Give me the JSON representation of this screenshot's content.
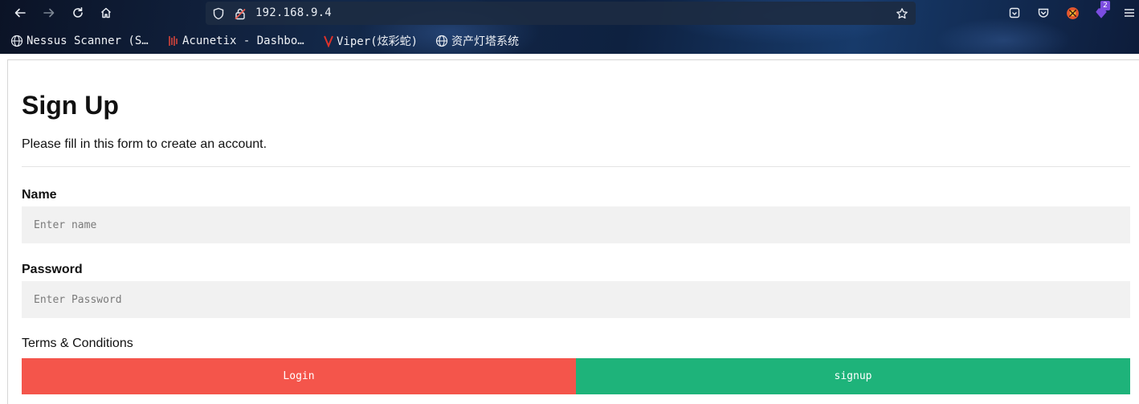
{
  "browser": {
    "url": "192.168.9.4",
    "bookmarks": [
      {
        "label": "Nessus Scanner (S…",
        "icon": "globe-icon"
      },
      {
        "label": "Acunetix - Dashbo…",
        "icon": "acunetix-icon"
      },
      {
        "label": "Viper(炫彩蛇)",
        "icon": "viper-icon"
      },
      {
        "label": "资产灯塔系统",
        "icon": "globe-icon"
      }
    ],
    "extension_badge": "2"
  },
  "form": {
    "title": "Sign Up",
    "subtitle": "Please fill in this form to create an account.",
    "name_label": "Name",
    "name_placeholder": "Enter name",
    "name_value": "",
    "password_label": "Password",
    "password_placeholder": "Enter Password",
    "password_value": "",
    "terms_text": "Terms & Conditions",
    "login_label": "Login",
    "signup_label": "signup"
  },
  "colors": {
    "login_button": "#f4554b",
    "signup_button": "#1eb37a",
    "input_bg": "#f1f1f1"
  }
}
